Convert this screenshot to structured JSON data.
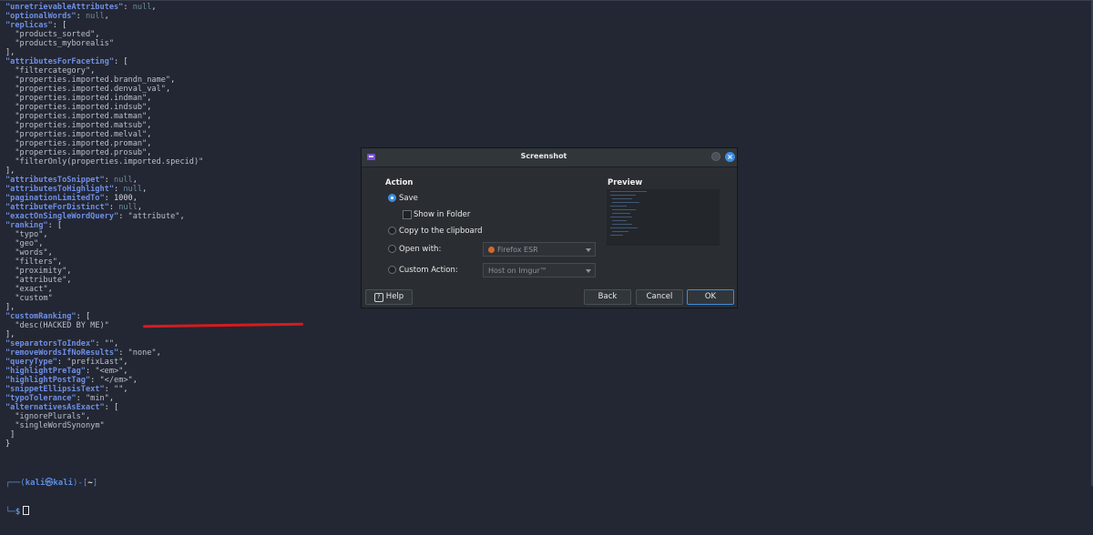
{
  "terminal": {
    "lines": [
      [
        [
          "k",
          "\"unretrievableAttributes\""
        ],
        [
          "p",
          ": "
        ],
        [
          "nl",
          "null"
        ],
        [
          "p",
          ","
        ]
      ],
      [
        [
          "k",
          "\"optionalWords\""
        ],
        [
          "p",
          ": "
        ],
        [
          "nl",
          "null"
        ],
        [
          "p",
          ","
        ]
      ],
      [
        [
          "k",
          "\"replicas\""
        ],
        [
          "p",
          ": ["
        ]
      ],
      [
        [
          "p",
          "  "
        ],
        [
          "s",
          "\"products_sorted\""
        ],
        [
          "p",
          ","
        ]
      ],
      [
        [
          "p",
          "  "
        ],
        [
          "s",
          "\"products_myborealis\""
        ]
      ],
      [
        [
          "p",
          "],"
        ]
      ],
      [
        [
          "k",
          "\"attributesForFaceting\""
        ],
        [
          "p",
          ": ["
        ]
      ],
      [
        [
          "p",
          "  "
        ],
        [
          "s",
          "\"filtercategory\""
        ],
        [
          "p",
          ","
        ]
      ],
      [
        [
          "p",
          "  "
        ],
        [
          "s",
          "\"properties.imported.brandn_name\""
        ],
        [
          "p",
          ","
        ]
      ],
      [
        [
          "p",
          "  "
        ],
        [
          "s",
          "\"properties.imported.denval_val\""
        ],
        [
          "p",
          ","
        ]
      ],
      [
        [
          "p",
          "  "
        ],
        [
          "s",
          "\"properties.imported.indman\""
        ],
        [
          "p",
          ","
        ]
      ],
      [
        [
          "p",
          "  "
        ],
        [
          "s",
          "\"properties.imported.indsub\""
        ],
        [
          "p",
          ","
        ]
      ],
      [
        [
          "p",
          "  "
        ],
        [
          "s",
          "\"properties.imported.matman\""
        ],
        [
          "p",
          ","
        ]
      ],
      [
        [
          "p",
          "  "
        ],
        [
          "s",
          "\"properties.imported.matsub\""
        ],
        [
          "p",
          ","
        ]
      ],
      [
        [
          "p",
          "  "
        ],
        [
          "s",
          "\"properties.imported.melval\""
        ],
        [
          "p",
          ","
        ]
      ],
      [
        [
          "p",
          "  "
        ],
        [
          "s",
          "\"properties.imported.proman\""
        ],
        [
          "p",
          ","
        ]
      ],
      [
        [
          "p",
          "  "
        ],
        [
          "s",
          "\"properties.imported.prosub\""
        ],
        [
          "p",
          ","
        ]
      ],
      [
        [
          "p",
          "  "
        ],
        [
          "s",
          "\"filterOnly(properties.imported.specid)\""
        ]
      ],
      [
        [
          "p",
          "],"
        ]
      ],
      [
        [
          "k",
          "\"attributesToSnippet\""
        ],
        [
          "p",
          ": "
        ],
        [
          "nl",
          "null"
        ],
        [
          "p",
          ","
        ]
      ],
      [
        [
          "k",
          "\"attributesToHighlight\""
        ],
        [
          "p",
          ": "
        ],
        [
          "nl",
          "null"
        ],
        [
          "p",
          ","
        ]
      ],
      [
        [
          "k",
          "\"paginationLimitedTo\""
        ],
        [
          "p",
          ": 1000,"
        ]
      ],
      [
        [
          "k",
          "\"attributeForDistinct\""
        ],
        [
          "p",
          ": "
        ],
        [
          "nl",
          "null"
        ],
        [
          "p",
          ","
        ]
      ],
      [
        [
          "k",
          "\"exactOnSingleWordQuery\""
        ],
        [
          "p",
          ": "
        ],
        [
          "s",
          "\"attribute\""
        ],
        [
          "p",
          ","
        ]
      ],
      [
        [
          "k",
          "\"ranking\""
        ],
        [
          "p",
          ": ["
        ]
      ],
      [
        [
          "p",
          "  "
        ],
        [
          "s",
          "\"typo\""
        ],
        [
          "p",
          ","
        ]
      ],
      [
        [
          "p",
          "  "
        ],
        [
          "s",
          "\"geo\""
        ],
        [
          "p",
          ","
        ]
      ],
      [
        [
          "p",
          "  "
        ],
        [
          "s",
          "\"words\""
        ],
        [
          "p",
          ","
        ]
      ],
      [
        [
          "p",
          "  "
        ],
        [
          "s",
          "\"filters\""
        ],
        [
          "p",
          ","
        ]
      ],
      [
        [
          "p",
          "  "
        ],
        [
          "s",
          "\"proximity\""
        ],
        [
          "p",
          ","
        ]
      ],
      [
        [
          "p",
          "  "
        ],
        [
          "s",
          "\"attribute\""
        ],
        [
          "p",
          ","
        ]
      ],
      [
        [
          "p",
          "  "
        ],
        [
          "s",
          "\"exact\""
        ],
        [
          "p",
          ","
        ]
      ],
      [
        [
          "p",
          "  "
        ],
        [
          "s",
          "\"custom\""
        ]
      ],
      [
        [
          "p",
          "],"
        ]
      ],
      [
        [
          "k",
          "\"customRanking\""
        ],
        [
          "p",
          ": ["
        ]
      ],
      [
        [
          "p",
          "  "
        ],
        [
          "s",
          "\"desc(HACKED BY ME)\""
        ]
      ],
      [
        [
          "p",
          "],"
        ]
      ],
      [
        [
          "k",
          "\"separatorsToIndex\""
        ],
        [
          "p",
          ": "
        ],
        [
          "s",
          "\"\""
        ],
        [
          "p",
          ","
        ]
      ],
      [
        [
          "k",
          "\"removeWordsIfNoResults\""
        ],
        [
          "p",
          ": "
        ],
        [
          "s",
          "\"none\""
        ],
        [
          "p",
          ","
        ]
      ],
      [
        [
          "k",
          "\"queryType\""
        ],
        [
          "p",
          ": "
        ],
        [
          "s",
          "\"prefixLast\""
        ],
        [
          "p",
          ","
        ]
      ],
      [
        [
          "k",
          "\"highlightPreTag\""
        ],
        [
          "p",
          ": "
        ],
        [
          "s",
          "\"<em>\""
        ],
        [
          "p",
          ","
        ]
      ],
      [
        [
          "k",
          "\"highlightPostTag\""
        ],
        [
          "p",
          ": "
        ],
        [
          "s",
          "\"</em>\""
        ],
        [
          "p",
          ","
        ]
      ],
      [
        [
          "k",
          "\"snippetEllipsisText\""
        ],
        [
          "p",
          ": "
        ],
        [
          "s",
          "\"\""
        ],
        [
          "p",
          ","
        ]
      ],
      [
        [
          "k",
          "\"typoTolerance\""
        ],
        [
          "p",
          ": "
        ],
        [
          "s",
          "\"min\""
        ],
        [
          "p",
          ","
        ]
      ],
      [
        [
          "k",
          "\"alternativesAsExact\""
        ],
        [
          "p",
          ": ["
        ]
      ],
      [
        [
          "p",
          "  "
        ],
        [
          "s",
          "\"ignorePlurals\""
        ],
        [
          "p",
          ","
        ]
      ],
      [
        [
          "p",
          "  "
        ],
        [
          "s",
          "\"singleWordSynonym\""
        ]
      ],
      [
        [
          "p",
          " ]"
        ]
      ],
      [
        [
          "p",
          "}"
        ]
      ]
    ],
    "prompt_line1_prefix": "┌──(",
    "prompt_user": "kali㉿kali",
    "prompt_line1_mid": ")-[",
    "prompt_path": "~",
    "prompt_line1_suffix": "]",
    "prompt_line2_prefix": "└─",
    "prompt_symbol": "$"
  },
  "dialog": {
    "title": "Screenshot",
    "action_header": "Action",
    "preview_header": "Preview",
    "options": {
      "save": "Save",
      "show_in_folder": "Show in Folder",
      "copy_clipboard": "Copy to the clipboard",
      "open_with": "Open with:",
      "custom_action": "Custom Action:"
    },
    "selected_action": "Save",
    "open_with_value": "Firefox ESR",
    "custom_action_value": "Host on Imgur™",
    "buttons": {
      "help": "Help",
      "back": "Back",
      "cancel": "Cancel",
      "ok": "OK"
    },
    "accent_color": "#3d8ee0"
  },
  "annotation_color": "#d81b1b"
}
